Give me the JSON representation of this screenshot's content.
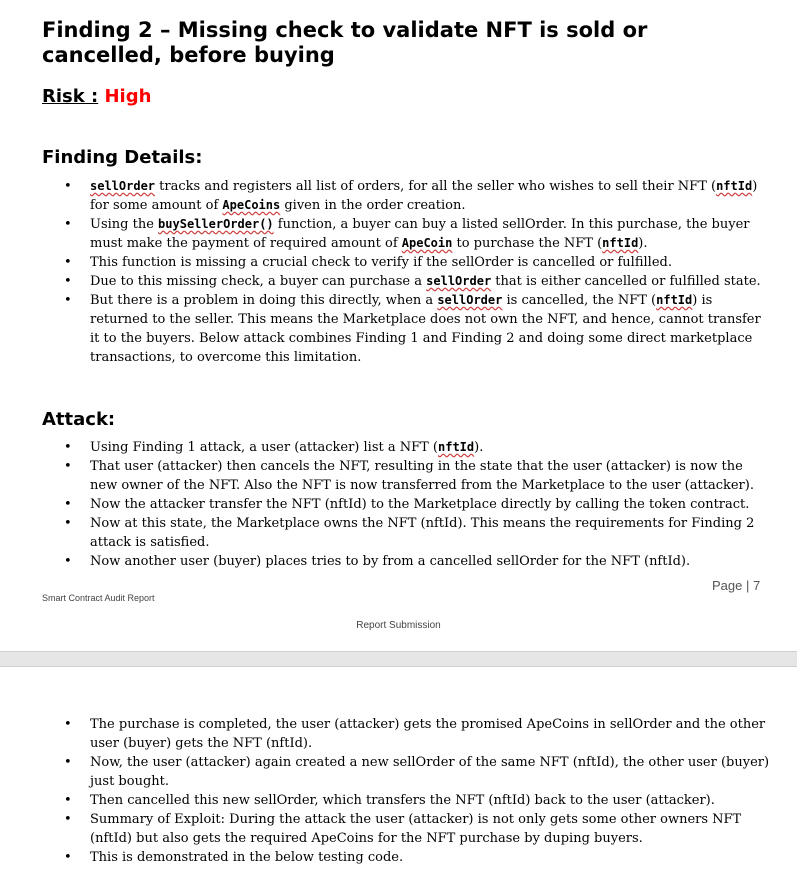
{
  "title": "Finding 2 – Missing check to validate NFT is sold or cancelled, before buying",
  "risk": {
    "label": "Risk :",
    "value": "High",
    "value_color": "#ff0000"
  },
  "details": {
    "heading": "Finding Details:",
    "items": [
      {
        "c1": "sellOrder",
        "t1": " tracks and registers all list of orders, for all the seller who wishes to sell their NFT (",
        "c2": "nftId",
        "t2": ") for some amount of ",
        "c3": "ApeCoins",
        "t3": " given in the order creation."
      },
      {
        "t0": "Using the ",
        "c1": "buySellerOrder()",
        "t1": " function, a buyer can buy a listed sellOrder. In this purchase, the buyer must make the payment of required amount of ",
        "c2": "ApeCoin",
        "t2": " to purchase the NFT (",
        "c3": "nftId",
        "t3": ")."
      },
      {
        "t0": "This function is missing a crucial check to verify if the sellOrder is cancelled or fulfilled."
      },
      {
        "t0": "Due to this missing check, a buyer can purchase a ",
        "c1": "sellOrder",
        "t1": " that is either cancelled or fulfilled state."
      },
      {
        "t0": "But there is a problem in doing this directly, when a ",
        "c1": "sellOrder",
        "t1": " is cancelled, the NFT (",
        "c2": "nftId",
        "t2": ") is returned to the seller. This means the Marketplace does not own the NFT, and hence, cannot transfer it to the buyers. Below attack combines Finding 1 and Finding 2 and doing some direct marketplace transactions, to overcome this limitation."
      }
    ]
  },
  "attack": {
    "heading": "Attack:",
    "items": [
      {
        "t0": "Using Finding 1 attack, a user (attacker) list a NFT (",
        "c1": "nftId",
        "t1": ")."
      },
      {
        "t0": "That user (attacker) then cancels the NFT, resulting in the state that the user (attacker) is now the new owner of the NFT. Also the NFT is now transferred from the Marketplace to the user (attacker)."
      },
      {
        "t0": "Now the attacker transfer the NFT (nftId) to the Marketplace directly by calling the token contract."
      },
      {
        "t0": "Now at this state, the Marketplace owns the NFT (nftId). This means the requirements for Finding 2 attack is satisfied."
      },
      {
        "t0": "Now another user (buyer) places tries to by from a cancelled sellOrder for the NFT (nftId)."
      }
    ]
  },
  "footer": {
    "left": "Smart Contract Audit Report",
    "page": "Page | 7",
    "center": "Report Submission"
  },
  "page2": {
    "items": [
      {
        "t0": "The purchase is completed, the user (attacker) gets the promised ApeCoins in sellOrder and the other user (buyer) gets the NFT (nftId)."
      },
      {
        "t0": "Now, the user (attacker) again created a new sellOrder of the same NFT (nftId), the other user (buyer) just bought."
      },
      {
        "t0": "Then cancelled this new sellOrder, which transfers the NFT (nftId) back to the user (attacker)."
      },
      {
        "t0": "Summary of Exploit: During the attack the user (attacker) is not only gets some other owners NFT (nftId) but also gets the required ApeCoins for the NFT purchase by duping buyers."
      },
      {
        "t0": "This is demonstrated in the below testing code."
      }
    ]
  }
}
